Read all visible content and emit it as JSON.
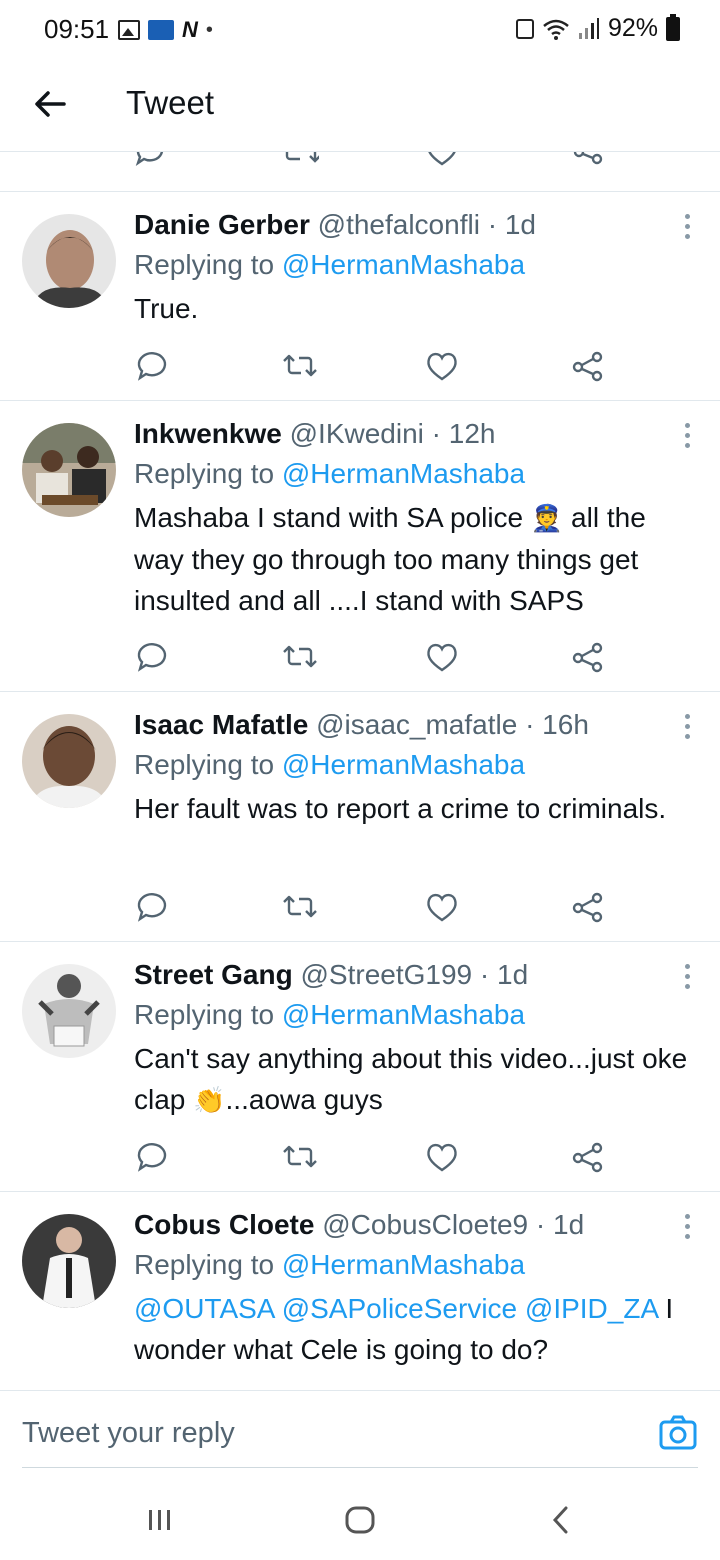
{
  "status_bar": {
    "time": "09:51",
    "battery": "92%"
  },
  "header": {
    "title": "Tweet"
  },
  "tweets": [
    {
      "display_name": "Danie Gerber",
      "handle": "@thefalconfli",
      "time": "· 1d",
      "replying_prefix": "Replying to",
      "replying_to": "@HermanMashaba",
      "text": "True.",
      "avatar_color": "#6b6b6b"
    },
    {
      "display_name": "Inkwenkwe",
      "handle": "@IKwedini",
      "time": "· 12h",
      "replying_prefix": "Replying to",
      "replying_to": "@HermanMashaba",
      "text_before_emoji": "Mashaba I stand with SA police",
      "emoji": "👮",
      "text_after_emoji": " all the way they go through too many things get insulted and all ....I stand with SAPS",
      "avatar_color": "#8a7a68"
    },
    {
      "display_name": "Isaac Mafatle",
      "handle": "@isaac_mafatle",
      "time": "· 16h",
      "replying_prefix": "Replying to",
      "replying_to": "@HermanMashaba",
      "text": "Her fault was to report a crime to criminals.",
      "avatar_color": "#6b4a36"
    },
    {
      "display_name": "Street Gang",
      "handle": "@StreetG199",
      "time": "· 1d",
      "replying_prefix": "Replying to",
      "replying_to": "@HermanMashaba",
      "text_before_emoji": "Can't say anything about this video...just oke clap",
      "emoji": "👏",
      "text_after_emoji": "...aowa guys",
      "avatar_color": "#d8d8d8"
    },
    {
      "display_name": "Cobus Cloete",
      "handle": "@CobusCloete9",
      "time": "· 1d",
      "replying_prefix": "Replying to",
      "replying_to": "@HermanMashaba",
      "mentions": "@OUTASA @SAPoliceService @IPID_ZA",
      "text_after_mentions": " I wonder what Cele is going to do?",
      "avatar_color": "#4a4a4a"
    }
  ],
  "reply_bar": {
    "placeholder": "Tweet your reply"
  },
  "colors": {
    "accent": "#1d9bf0",
    "secondary_text": "#536471",
    "divider": "#e1e8ed"
  }
}
